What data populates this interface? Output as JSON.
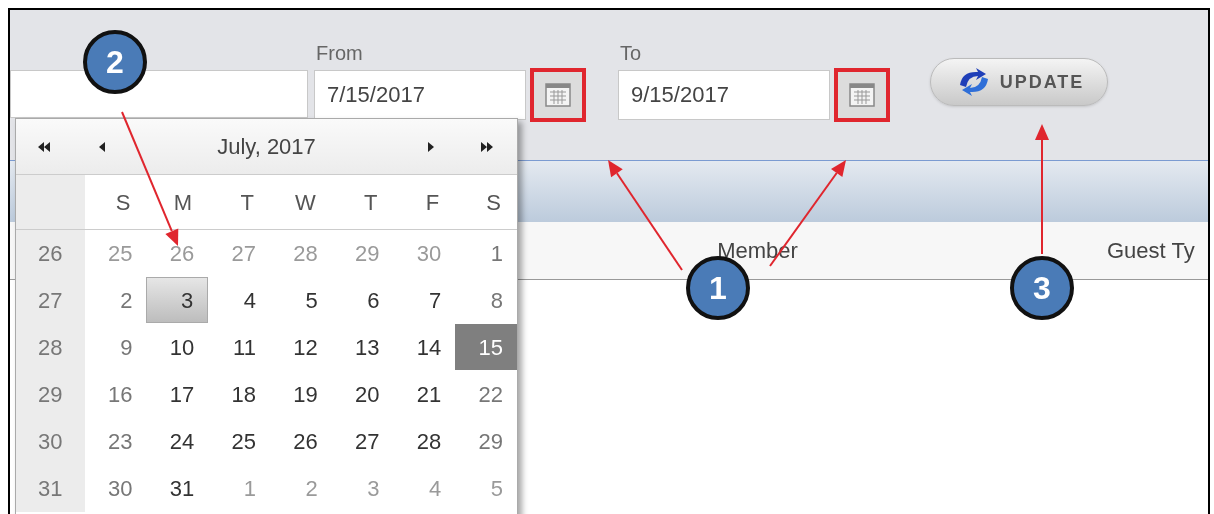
{
  "filters": [
    {
      "label": "From",
      "value": "7/15/2017",
      "highlighted": true
    },
    {
      "label": "To",
      "value": "9/15/2017",
      "highlighted": true
    }
  ],
  "update_button": {
    "label": "UPDATE"
  },
  "table": {
    "columns": [
      "Member",
      "Guest Ty"
    ]
  },
  "calendar": {
    "title": "July, 2017",
    "weekdays": [
      "S",
      "M",
      "T",
      "W",
      "T",
      "F",
      "S"
    ],
    "weeks": [
      {
        "number": "26",
        "days": [
          {
            "day": "25",
            "kind": "other-month",
            "today": false,
            "selected": false
          },
          {
            "day": "26",
            "kind": "other-month",
            "today": false,
            "selected": false
          },
          {
            "day": "27",
            "kind": "other-month",
            "today": false,
            "selected": false
          },
          {
            "day": "28",
            "kind": "other-month",
            "today": false,
            "selected": false
          },
          {
            "day": "29",
            "kind": "other-month",
            "today": false,
            "selected": false
          },
          {
            "day": "30",
            "kind": "other-month",
            "today": false,
            "selected": false
          },
          {
            "day": "1",
            "kind": "weekend",
            "today": false,
            "selected": false
          }
        ]
      },
      {
        "number": "27",
        "days": [
          {
            "day": "2",
            "kind": "weekend",
            "today": false,
            "selected": false
          },
          {
            "day": "3",
            "kind": "weekday",
            "today": true,
            "selected": false
          },
          {
            "day": "4",
            "kind": "weekday",
            "today": false,
            "selected": false
          },
          {
            "day": "5",
            "kind": "weekday",
            "today": false,
            "selected": false
          },
          {
            "day": "6",
            "kind": "weekday",
            "today": false,
            "selected": false
          },
          {
            "day": "7",
            "kind": "weekday",
            "today": false,
            "selected": false
          },
          {
            "day": "8",
            "kind": "weekend",
            "today": false,
            "selected": false
          }
        ]
      },
      {
        "number": "28",
        "days": [
          {
            "day": "9",
            "kind": "weekend",
            "today": false,
            "selected": false
          },
          {
            "day": "10",
            "kind": "weekday",
            "today": false,
            "selected": false
          },
          {
            "day": "11",
            "kind": "weekday",
            "today": false,
            "selected": false
          },
          {
            "day": "12",
            "kind": "weekday",
            "today": false,
            "selected": false
          },
          {
            "day": "13",
            "kind": "weekday",
            "today": false,
            "selected": false
          },
          {
            "day": "14",
            "kind": "weekday",
            "today": false,
            "selected": false
          },
          {
            "day": "15",
            "kind": "weekend",
            "today": false,
            "selected": true
          }
        ]
      },
      {
        "number": "29",
        "days": [
          {
            "day": "16",
            "kind": "weekend",
            "today": false,
            "selected": false
          },
          {
            "day": "17",
            "kind": "weekday",
            "today": false,
            "selected": false
          },
          {
            "day": "18",
            "kind": "weekday",
            "today": false,
            "selected": false
          },
          {
            "day": "19",
            "kind": "weekday",
            "today": false,
            "selected": false
          },
          {
            "day": "20",
            "kind": "weekday",
            "today": false,
            "selected": false
          },
          {
            "day": "21",
            "kind": "weekday",
            "today": false,
            "selected": false
          },
          {
            "day": "22",
            "kind": "weekend",
            "today": false,
            "selected": false
          }
        ]
      },
      {
        "number": "30",
        "days": [
          {
            "day": "23",
            "kind": "weekend",
            "today": false,
            "selected": false
          },
          {
            "day": "24",
            "kind": "weekday",
            "today": false,
            "selected": false
          },
          {
            "day": "25",
            "kind": "weekday",
            "today": false,
            "selected": false
          },
          {
            "day": "26",
            "kind": "weekday",
            "today": false,
            "selected": false
          },
          {
            "day": "27",
            "kind": "weekday",
            "today": false,
            "selected": false
          },
          {
            "day": "28",
            "kind": "weekday",
            "today": false,
            "selected": false
          },
          {
            "day": "29",
            "kind": "weekend",
            "today": false,
            "selected": false
          }
        ]
      },
      {
        "number": "31",
        "days": [
          {
            "day": "30",
            "kind": "weekend",
            "today": false,
            "selected": false
          },
          {
            "day": "31",
            "kind": "weekday",
            "today": false,
            "selected": false
          },
          {
            "day": "1",
            "kind": "other-month",
            "today": false,
            "selected": false
          },
          {
            "day": "2",
            "kind": "other-month",
            "today": false,
            "selected": false
          },
          {
            "day": "3",
            "kind": "other-month",
            "today": false,
            "selected": false
          },
          {
            "day": "4",
            "kind": "other-month",
            "today": false,
            "selected": false
          },
          {
            "day": "5",
            "kind": "other-month",
            "today": false,
            "selected": false
          }
        ]
      }
    ]
  },
  "callouts": [
    {
      "label": "2"
    },
    {
      "label": "1"
    },
    {
      "label": "3"
    }
  ]
}
